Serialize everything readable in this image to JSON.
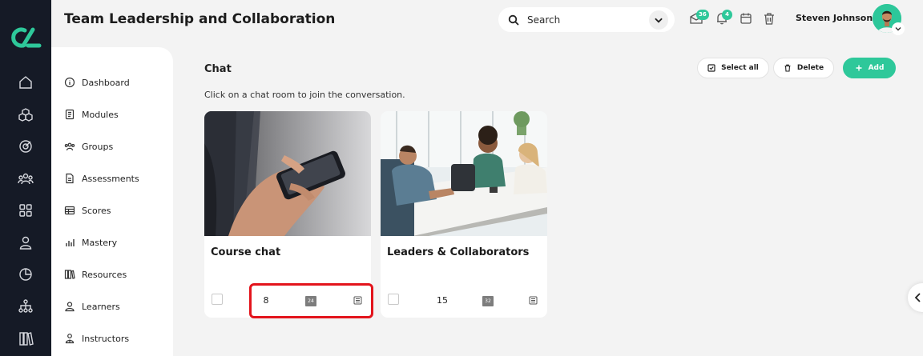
{
  "header": {
    "title": "Team Leadership and Collaboration",
    "search_placeholder": "Search",
    "messages_count": "36",
    "notifications_count": "4",
    "user_name": "Steven Johnson"
  },
  "rail": {
    "logo": "app-logo",
    "items": [
      "home-icon",
      "modules-icon",
      "target-icon",
      "groups-icon",
      "grid-icon",
      "user-icon",
      "pie-chart-icon",
      "hierarchy-icon",
      "library-icon"
    ]
  },
  "sidebar": {
    "items": [
      {
        "label": "Dashboard",
        "icon": "info-icon"
      },
      {
        "label": "Modules",
        "icon": "book-icon"
      },
      {
        "label": "Groups",
        "icon": "groups-icon"
      },
      {
        "label": "Assessments",
        "icon": "document-icon"
      },
      {
        "label": "Scores",
        "icon": "table-icon"
      },
      {
        "label": "Mastery",
        "icon": "bar-chart-icon"
      },
      {
        "label": "Resources",
        "icon": "library-icon"
      },
      {
        "label": "Learners",
        "icon": "user-icon"
      },
      {
        "label": "Instructors",
        "icon": "instructor-icon"
      }
    ]
  },
  "main": {
    "title": "Chat",
    "hint": "Click on a chat room to join the conversation.",
    "actions": {
      "select_all": "Select all",
      "delete": "Delete",
      "add": "Add"
    },
    "cards": [
      {
        "title": "Course chat",
        "count": "8",
        "badge": "24"
      },
      {
        "title": "Leaders & Collaborators",
        "count": "15",
        "badge": "32"
      }
    ]
  },
  "colors": {
    "accent": "#2ec89a",
    "rail": "#151a26",
    "highlight": "#e3141c"
  }
}
